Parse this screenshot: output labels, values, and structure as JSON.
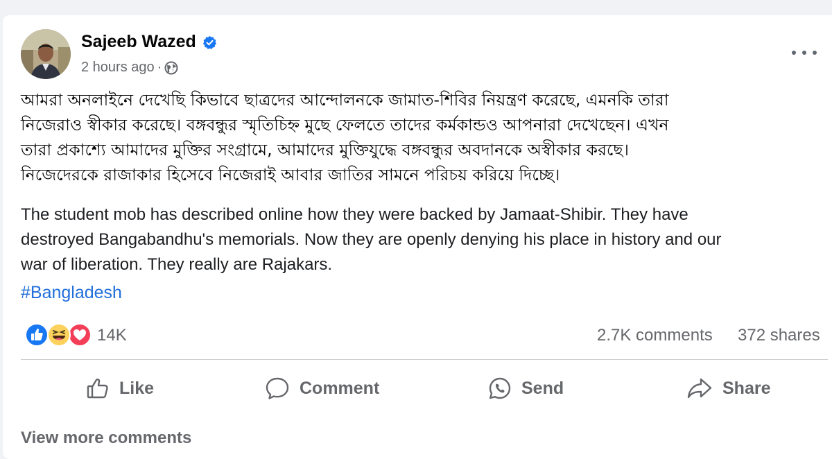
{
  "post": {
    "author": "Sajeeb Wazed",
    "verified_icon": "verified-badge-icon",
    "timestamp": "2 hours ago",
    "separator": "·",
    "audience_icon": "globe-icon",
    "options_icon": "more-options-icon",
    "bengali_lines": [
      "আমরা অনলাইনে দেখেছি কিভাবে ছাত্রদের আন্দোলনকে জামাত-শিবির নিয়ন্ত্রণ করেছে, এমনকি তারা",
      "নিজেরাও স্বীকার করেছে। বঙ্গবন্ধুর স্মৃতিচিহ্ন মুছে ফেলতে তাদের কর্মকান্ডও আপনারা দেখেছেন। এখন",
      "তারা প্রকাশ্যে আমাদের মুক্তির সংগ্রামে, আমাদের মুক্তিযুদ্ধে বঙ্গবন্ধুর অবদানকে অস্বীকার করছে।",
      "নিজেদেরকে রাজাকার হিসেবে নিজেরাই আবার জাতির সামনে পরিচয় করিয়ে দিচ্ছে।"
    ],
    "english_lines": [
      "The student mob has described online how they were backed by Jamaat-Shibir. They have",
      "destroyed Bangabandhu's memorials. Now they are openly denying his place in history and our",
      "war of liberation. They really are Rajakars."
    ],
    "hashtag": "#Bangladesh"
  },
  "stats": {
    "reaction_icons": [
      "like-reaction-icon",
      "haha-reaction-icon",
      "love-reaction-icon"
    ],
    "reactions": "14K",
    "comments": "2.7K comments",
    "shares": "372 shares"
  },
  "actions": {
    "like": "Like",
    "comment": "Comment",
    "send": "Send",
    "share": "Share"
  },
  "footer": {
    "view_more": "View more comments"
  },
  "colors": {
    "link_blue": "#216fdb",
    "muted_gray": "#65676b",
    "verified_blue": "#1877f2",
    "love_red": "#f33e58",
    "haha_yellow": "#fcd25c"
  }
}
